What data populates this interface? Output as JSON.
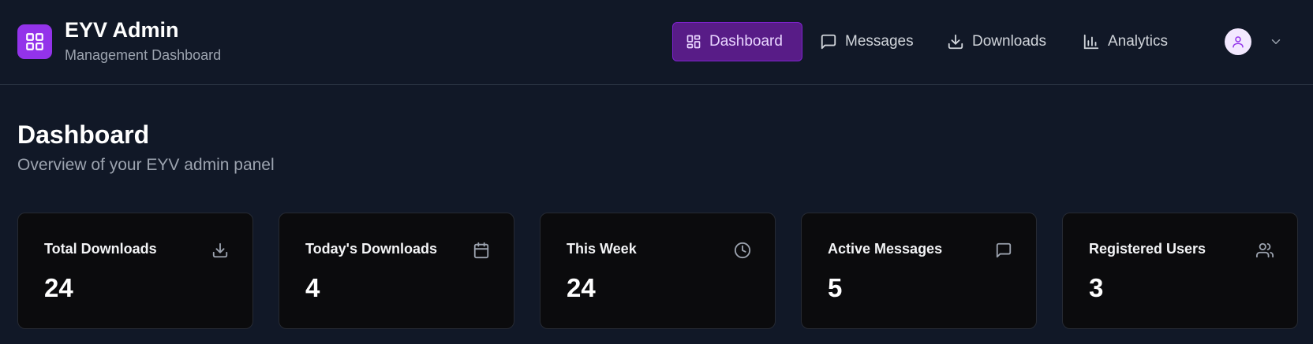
{
  "brand": {
    "title": "EYV Admin",
    "subtitle": "Management Dashboard",
    "logo_icon": "grid-icon",
    "accent": "#9333ea"
  },
  "nav": {
    "items": [
      {
        "label": "Dashboard",
        "icon": "layout-dashboard-icon",
        "active": true
      },
      {
        "label": "Messages",
        "icon": "message-square-icon",
        "active": false
      },
      {
        "label": "Downloads",
        "icon": "download-icon",
        "active": false
      },
      {
        "label": "Analytics",
        "icon": "bar-chart-icon",
        "active": false
      }
    ],
    "active_bg": "#581c87"
  },
  "user_menu": {
    "avatar_icon": "user-icon",
    "dropdown_icon": "chevron-down-icon"
  },
  "page": {
    "title": "Dashboard",
    "subtitle": "Overview of your EYV admin panel"
  },
  "stats": [
    {
      "label": "Total Downloads",
      "value": "24",
      "icon": "download-icon"
    },
    {
      "label": "Today's Downloads",
      "value": "4",
      "icon": "calendar-icon"
    },
    {
      "label": "This Week",
      "value": "24",
      "icon": "clock-icon"
    },
    {
      "label": "Active Messages",
      "value": "5",
      "icon": "message-square-icon"
    },
    {
      "label": "Registered Users",
      "value": "3",
      "icon": "users-icon"
    }
  ]
}
